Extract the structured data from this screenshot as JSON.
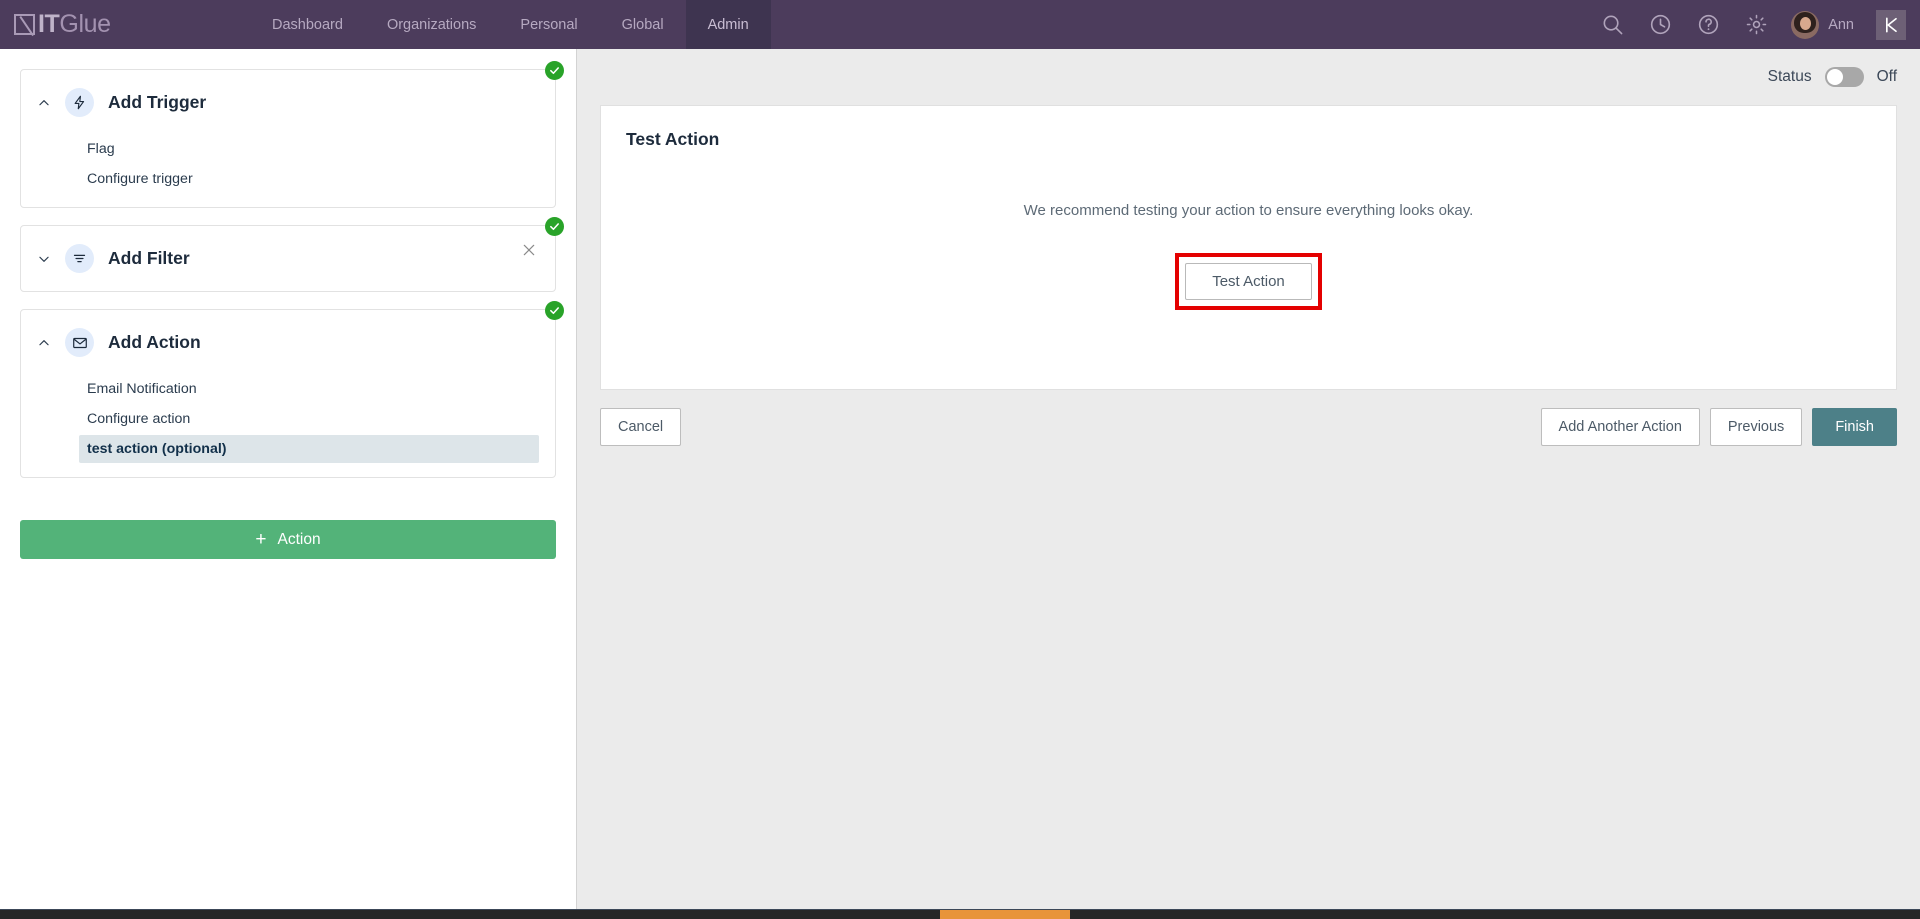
{
  "topnav": {
    "logo": {
      "bold": "IT",
      "light": "Glue",
      "mark_icon": "itglue-logo-mark"
    },
    "tabs": [
      {
        "label": "Dashboard",
        "active": false
      },
      {
        "label": "Organizations",
        "active": false
      },
      {
        "label": "Personal",
        "active": false
      },
      {
        "label": "Global",
        "active": false
      },
      {
        "label": "Admin",
        "active": true
      }
    ],
    "icons": [
      "search-icon",
      "history-clock-icon",
      "help-icon",
      "gear-icon"
    ],
    "user_name": "Ann",
    "kaseya_label": "K",
    "bg_color": "#4c3c5c",
    "active_tab_color": "#3e3450"
  },
  "left_panel": {
    "cards": [
      {
        "title": "Add Trigger",
        "icon": "lightning-bolt-icon",
        "expanded": true,
        "completed": true,
        "closable": false,
        "rows": [
          {
            "label": "Flag",
            "selected": false
          },
          {
            "label": "Configure trigger",
            "selected": false
          }
        ]
      },
      {
        "title": "Add Filter",
        "icon": "filter-icon",
        "expanded": false,
        "completed": true,
        "closable": true,
        "rows": []
      },
      {
        "title": "Add Action",
        "icon": "envelope-icon",
        "expanded": true,
        "completed": true,
        "closable": false,
        "rows": [
          {
            "label": "Email Notification",
            "selected": false
          },
          {
            "label": "Configure action",
            "selected": false
          },
          {
            "label": "test action (optional)",
            "selected": true
          }
        ]
      }
    ],
    "add_action_button": {
      "label": "Action",
      "plus": "+",
      "color": "#53b379"
    }
  },
  "main": {
    "status": {
      "label": "Status",
      "state": "Off",
      "enabled": false
    },
    "panel": {
      "title": "Test Action",
      "recommend_text": "We recommend testing your action to ensure everything looks okay.",
      "test_button_label": "Test Action",
      "highlight_color": "#e40000"
    },
    "footer": {
      "cancel_label": "Cancel",
      "add_another_action_label": "Add Another Action",
      "previous_label": "Previous",
      "finish_label": "Finish",
      "finish_color": "#4d8088"
    }
  }
}
